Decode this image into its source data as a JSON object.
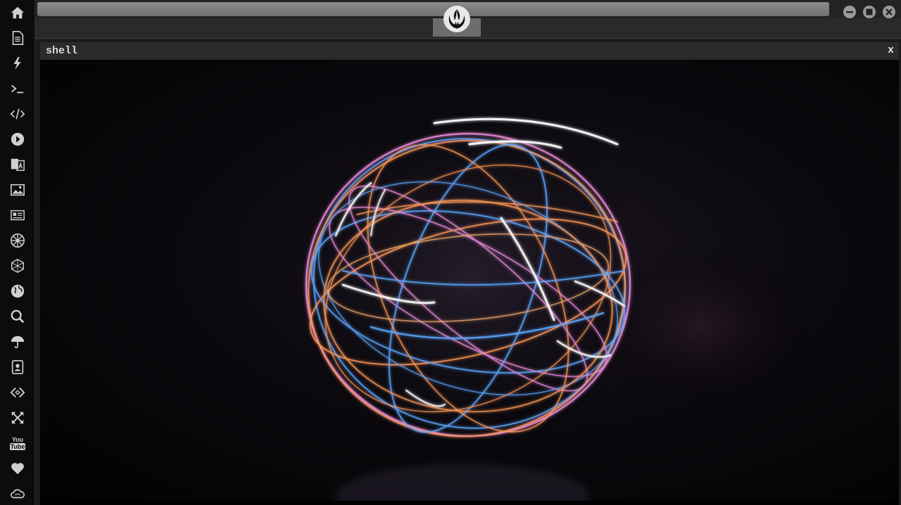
{
  "sidebar": {
    "items": [
      {
        "icon": "home-icon"
      },
      {
        "icon": "document-icon"
      },
      {
        "icon": "lightning-icon"
      },
      {
        "icon": "terminal-icon"
      },
      {
        "icon": "code-icon"
      },
      {
        "icon": "play-icon"
      },
      {
        "icon": "translate-icon"
      },
      {
        "icon": "image-icon"
      },
      {
        "icon": "newspaper-icon"
      },
      {
        "icon": "galactic-empire-icon"
      },
      {
        "icon": "hexagon-network-icon"
      },
      {
        "icon": "globe-icon"
      },
      {
        "icon": "search-icon"
      },
      {
        "icon": "umbrella-icon"
      },
      {
        "icon": "address-book-icon"
      },
      {
        "icon": "embed-code-icon"
      },
      {
        "icon": "expand-icon"
      },
      {
        "icon": "youtube-icon"
      },
      {
        "icon": "heart-icon"
      },
      {
        "icon": "cloud-icon"
      }
    ],
    "youtube_text_top": "You",
    "youtube_text_bottom": "Tube"
  },
  "header": {
    "logo_icon": "rebel-alliance-icon",
    "window_controls": [
      "minimize-icon",
      "maximize-icon",
      "close-icon"
    ]
  },
  "window": {
    "title": "shell",
    "close_label": "x"
  },
  "colors": {
    "sidebar_bg": "#0c0c0c",
    "titlebar_bg": "#2b2b2b",
    "icon_color": "#d0d0d0",
    "orb_blue": "#5aa8ff",
    "orb_orange": "#ff9a55",
    "orb_pink": "#e88ad8"
  }
}
